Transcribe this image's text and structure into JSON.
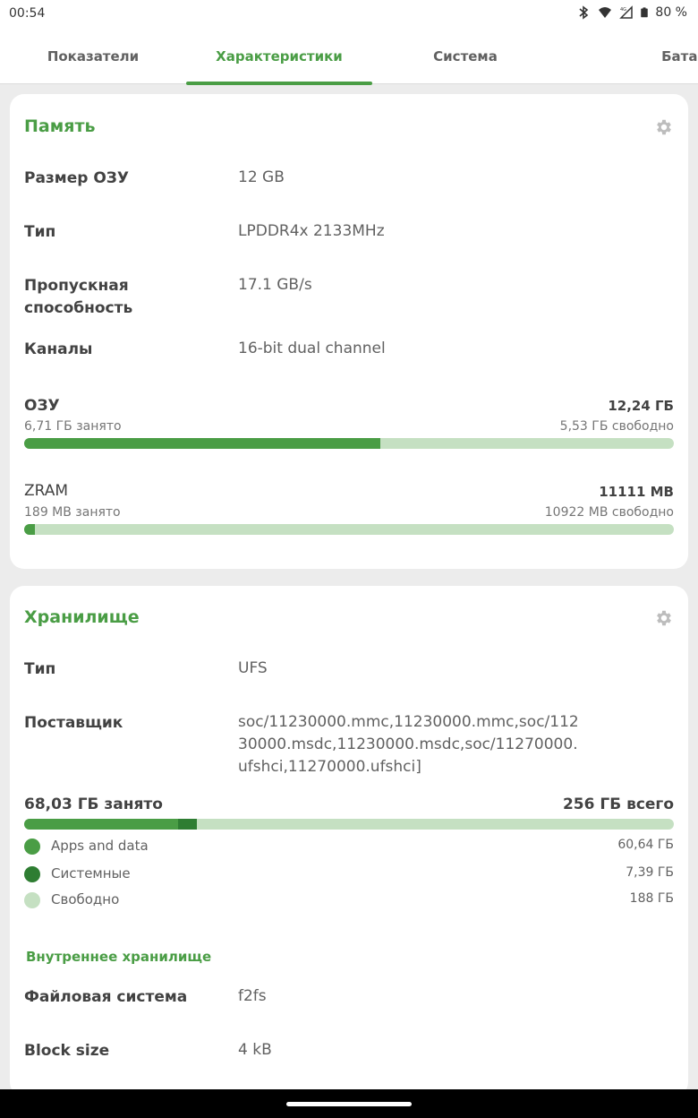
{
  "status_bar": {
    "time": "00:54",
    "battery": "80 %",
    "icons": [
      "bluetooth-icon",
      "wifi-icon",
      "signal-4g-icon",
      "battery-icon"
    ]
  },
  "tabs": [
    {
      "label": "Показатели",
      "active": false
    },
    {
      "label": "Характеристики",
      "active": true
    },
    {
      "label": "Система",
      "active": false
    },
    {
      "label": "Батарея",
      "active": false
    }
  ],
  "memory": {
    "title": "Память",
    "rows": [
      {
        "label": "Размер ОЗУ",
        "value": "12 GB"
      },
      {
        "label": "Тип",
        "value": "LPDDR4x 2133MHz"
      },
      {
        "label": "Пропускная способность",
        "value": "17.1 GB/s"
      },
      {
        "label": "Каналы",
        "value": "16-bit dual channel"
      }
    ],
    "ram": {
      "title": "ОЗУ",
      "total": "12,24 ГБ",
      "used": "6,71 ГБ занято",
      "free": "5,53 ГБ свободно",
      "fraction_used": 0.5482
    },
    "zram": {
      "title": "ZRAM",
      "total": "11111 MB",
      "used": "189 MB занято",
      "free": "10922 MB свободно",
      "fraction_used": 0.017
    }
  },
  "storage": {
    "title": "Хранилище",
    "rows": [
      {
        "label": "Тип",
        "value": "UFS"
      },
      {
        "label": "Поставщик",
        "value": "soc/11230000.mmc,11230000.mmc,soc/11230000.msdc,11230000.msdc,soc/11270000.ufshci,11270000.ufshci]"
      }
    ],
    "used_label": "68,03 ГБ занято",
    "total_label": "256 ГБ всего",
    "fraction_apps": 0.2369,
    "fraction_system": 0.0289,
    "legend": [
      {
        "label": "Apps and data",
        "value": "60,64 ГБ",
        "color": "#4a9d45"
      },
      {
        "label": "Системные",
        "value": "7,39 ГБ",
        "color": "#2e7d32"
      },
      {
        "label": "Свободно",
        "value": "188 ГБ",
        "color": "#c5e0c2"
      }
    ],
    "internal": {
      "title": "Внутреннее хранилище",
      "rows": [
        {
          "label": "Файловая система",
          "value": "f2fs"
        },
        {
          "label": "Block size",
          "value": "4 kB"
        }
      ]
    }
  },
  "colors": {
    "accent": "#4a9d45",
    "accent_dark": "#2e7d32",
    "track": "#c5e0c2"
  }
}
